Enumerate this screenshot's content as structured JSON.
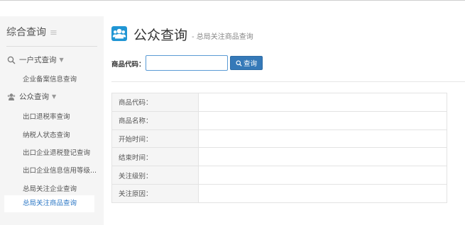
{
  "sidebar": {
    "title": "综合查询",
    "groups": [
      {
        "label": "一户式查询",
        "icon": "search-icon",
        "items": [
          {
            "label": "企业备案信息查询"
          }
        ]
      },
      {
        "label": "公众查询",
        "icon": "users-icon",
        "items": [
          {
            "label": "出口退税率查询"
          },
          {
            "label": "纳税人状态查询"
          },
          {
            "label": "出口企业退税登记查询"
          },
          {
            "label": "出口企业信息信用等级..."
          },
          {
            "label": "总局关注企业查询"
          },
          {
            "label": "总局关注商品查询",
            "active": true
          }
        ]
      }
    ]
  },
  "header": {
    "title": "公众查询",
    "subtitle": "- 总局关注商品查询",
    "icon": "users-icon",
    "accent": "#2196d4"
  },
  "search": {
    "label": "商品代码：",
    "value": "",
    "placeholder": "",
    "button_label": "查询"
  },
  "details": {
    "rows": [
      {
        "key": "商品代码：",
        "value": ""
      },
      {
        "key": "商品名称：",
        "value": ""
      },
      {
        "key": "开始时间：",
        "value": ""
      },
      {
        "key": "结束时间：",
        "value": ""
      },
      {
        "key": "关注级别：",
        "value": ""
      },
      {
        "key": "关注原因：",
        "value": ""
      }
    ]
  },
  "colors": {
    "button": "#3579b8",
    "active_link": "#2d78c6",
    "sidebar_bg": "#f5f5f5"
  }
}
